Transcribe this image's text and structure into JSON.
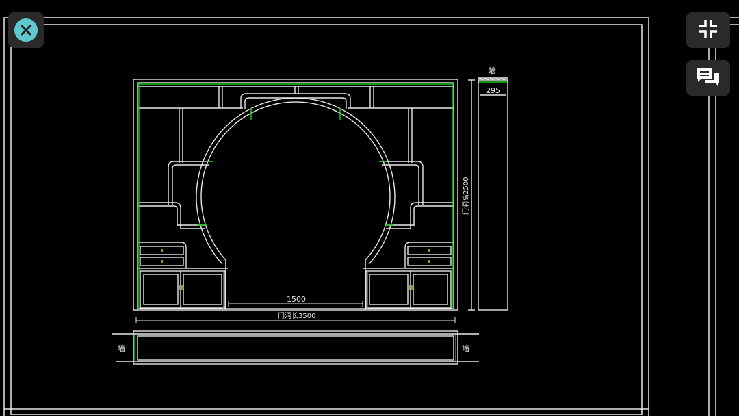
{
  "colors": {
    "background": "#000000",
    "line_white": "#e8e8e8",
    "line_green": "#1ec81e",
    "accent_close": "#5fc9cf",
    "button_bg": "#2a2a2a",
    "handle_yellow": "#d8c200"
  },
  "toolbar": {
    "close_icon": "close-icon",
    "collapse_icon": "collapse-fullscreen-icon",
    "comment_icon": "comments-icon"
  },
  "drawing": {
    "label_wall_top": "墙",
    "dim_depth": "295",
    "dim_door_height": "门洞高2500",
    "dim_opening_width": "1500",
    "dim_door_length": "门洞长3500",
    "label_wall_left": "墙",
    "label_wall_right": "墙"
  }
}
